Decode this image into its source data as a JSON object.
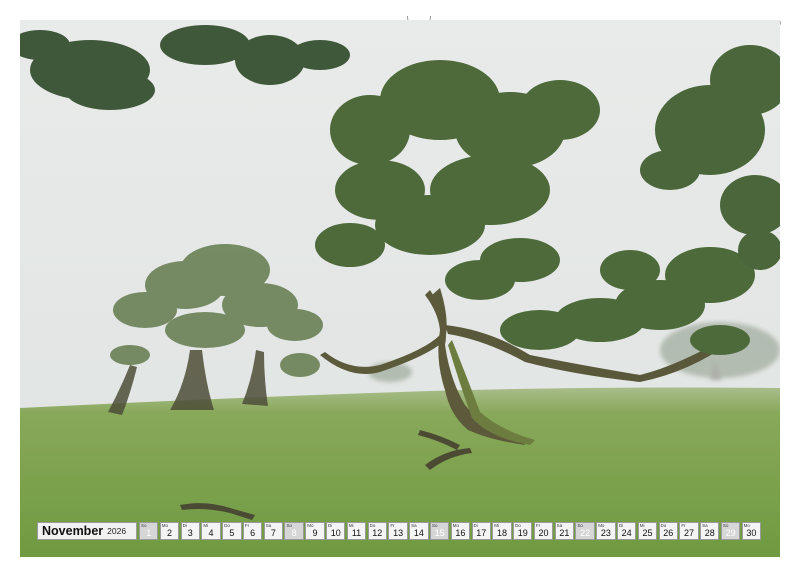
{
  "calendar": {
    "month": "November",
    "year": "2026",
    "days": [
      {
        "n": "1",
        "wd": "So",
        "weekend": true
      },
      {
        "n": "2",
        "wd": "Mo",
        "weekend": false
      },
      {
        "n": "3",
        "wd": "Di",
        "weekend": false
      },
      {
        "n": "4",
        "wd": "Mi",
        "weekend": false
      },
      {
        "n": "5",
        "wd": "Do",
        "weekend": false
      },
      {
        "n": "6",
        "wd": "Fr",
        "weekend": false
      },
      {
        "n": "7",
        "wd": "Sa",
        "weekend": false
      },
      {
        "n": "8",
        "wd": "So",
        "weekend": true
      },
      {
        "n": "9",
        "wd": "Mo",
        "weekend": false
      },
      {
        "n": "10",
        "wd": "Di",
        "weekend": false
      },
      {
        "n": "11",
        "wd": "Mi",
        "weekend": false
      },
      {
        "n": "12",
        "wd": "Do",
        "weekend": false
      },
      {
        "n": "13",
        "wd": "Fr",
        "weekend": false
      },
      {
        "n": "14",
        "wd": "Sa",
        "weekend": false
      },
      {
        "n": "15",
        "wd": "So",
        "weekend": true
      },
      {
        "n": "16",
        "wd": "Mo",
        "weekend": false
      },
      {
        "n": "17",
        "wd": "Di",
        "weekend": false
      },
      {
        "n": "18",
        "wd": "Mi",
        "weekend": false
      },
      {
        "n": "19",
        "wd": "Do",
        "weekend": false
      },
      {
        "n": "20",
        "wd": "Fr",
        "weekend": false
      },
      {
        "n": "21",
        "wd": "Sa",
        "weekend": false
      },
      {
        "n": "22",
        "wd": "So",
        "weekend": true
      },
      {
        "n": "23",
        "wd": "Mo",
        "weekend": false
      },
      {
        "n": "24",
        "wd": "Di",
        "weekend": false
      },
      {
        "n": "25",
        "wd": "Mi",
        "weekend": false
      },
      {
        "n": "26",
        "wd": "Do",
        "weekend": false
      },
      {
        "n": "27",
        "wd": "Fr",
        "weekend": false
      },
      {
        "n": "28",
        "wd": "Sa",
        "weekend": false
      },
      {
        "n": "29",
        "wd": "So",
        "weekend": true
      },
      {
        "n": "30",
        "wd": "Mo",
        "weekend": false
      }
    ]
  },
  "colors": {
    "fog": "#e4e7e6",
    "grass": "#7aa04a",
    "foliage": "#4f6b3c",
    "bark": "#5a5a3a",
    "weekend_cell": "#d6d6d6"
  }
}
